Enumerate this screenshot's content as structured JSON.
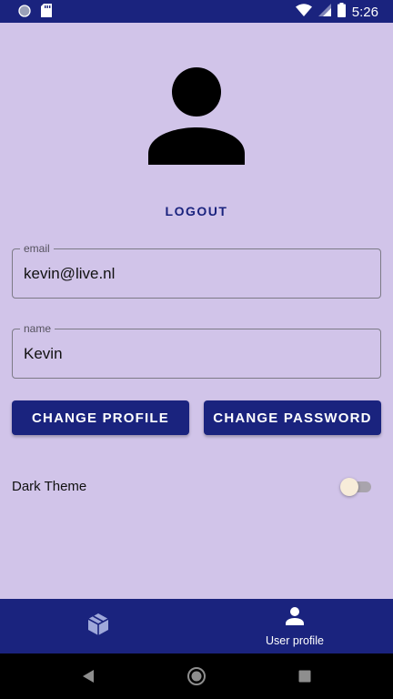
{
  "status_bar": {
    "time": "5:26"
  },
  "profile": {
    "logout_label": "LOGOUT"
  },
  "fields": {
    "email": {
      "label": "email",
      "value": "kevin@live.nl"
    },
    "name": {
      "label": "name",
      "value": "Kevin"
    }
  },
  "buttons": {
    "change_profile": "CHANGE PROFILE",
    "change_password": "CHANGE PASSWORD"
  },
  "settings": {
    "dark_theme_label": "Dark Theme",
    "dark_theme_on": false
  },
  "bottom_nav": {
    "items": [
      {
        "icon": "box-icon",
        "label": "",
        "selected": false
      },
      {
        "icon": "person-icon",
        "label": "User profile",
        "selected": true
      }
    ]
  },
  "colors": {
    "primary": "#1a237e",
    "background": "#d1c4e9",
    "inactive_nav_icon": "#9fa8da"
  }
}
